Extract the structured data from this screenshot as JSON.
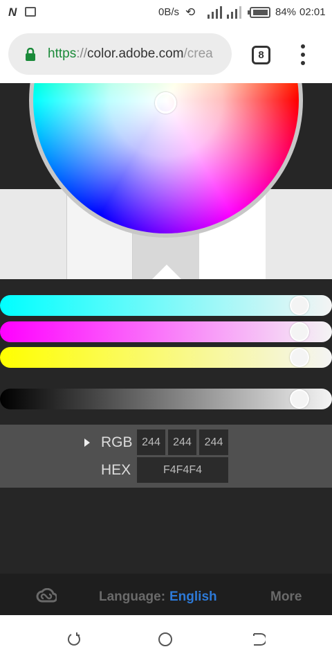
{
  "status_bar": {
    "notification_icon": "N",
    "network_speed": "0B/s",
    "battery_percent": "84%",
    "time": "02:01"
  },
  "browser": {
    "url_protocol": "https",
    "url_separator": "://",
    "url_host": "color.adobe.com",
    "url_path": "/crea",
    "tab_count": "8"
  },
  "color_wheel": {
    "swatches": [
      "#e9e9e9",
      "#f4f4f4",
      "#d8d8d8",
      "#ffffff",
      "#e9e9e9"
    ],
    "selected_swatch_index": 2
  },
  "sliders": {
    "cyan": {
      "value": 0.96
    },
    "magenta": {
      "value": 0.96
    },
    "yellow": {
      "value": 0.96
    },
    "black": {
      "value": 0.96
    }
  },
  "values": {
    "rgb_label": "RGB",
    "hex_label": "HEX",
    "r": "244",
    "g": "244",
    "b": "244",
    "hex": "F4F4F4"
  },
  "footer": {
    "language_label": "Language:",
    "language_value": "English",
    "more_label": "More"
  },
  "colors": {
    "accent_blue": "#2d7ad8",
    "url_green": "#1b8a3a"
  }
}
